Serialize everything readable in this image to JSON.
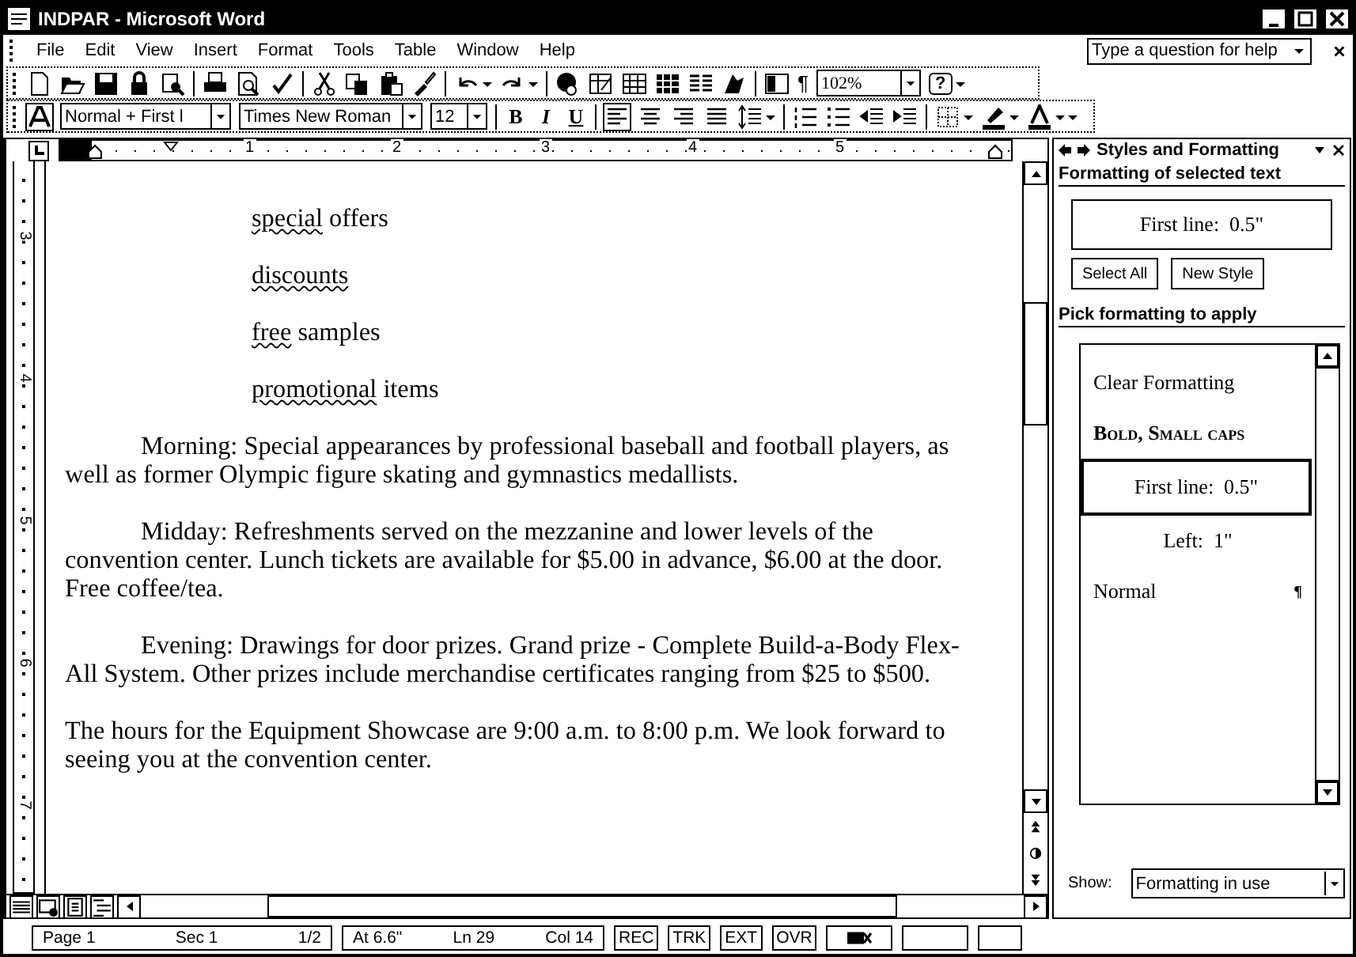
{
  "window": {
    "title": "INDPAR - Microsoft Word"
  },
  "menu": [
    "File",
    "Edit",
    "View",
    "Insert",
    "Format",
    "Tools",
    "Table",
    "Window",
    "Help"
  ],
  "help_search": {
    "placeholder": "Type a question for help"
  },
  "standard_toolbar": {
    "show_formatting": "¶",
    "zoom": "102%",
    "help": "?"
  },
  "formatting_toolbar": {
    "style": "Normal + First l",
    "font": "Times New Roman",
    "size": "12",
    "bold": "B",
    "italic": "I",
    "underline": "U",
    "alignment_buttons": [
      {
        "selected": true
      },
      {
        "selected": false
      },
      {
        "selected": false
      },
      {
        "selected": false
      }
    ]
  },
  "ruler": {
    "labels": [
      "1",
      "2",
      "3",
      "4",
      "5"
    ]
  },
  "vertical_ruler": {
    "labels": [
      "3",
      "4",
      "5",
      "6",
      "7"
    ]
  },
  "document": {
    "list_items": [
      {
        "flagged_word": "special",
        "text": "offers"
      },
      {
        "flagged_word": "discounts"
      },
      {
        "flagged_word": "free",
        "text": "samples"
      },
      {
        "flagged_word": "promotional",
        "text": "items"
      }
    ],
    "paragraphs": [
      {
        "first_line_indent": true,
        "lines": [
          "Morning: Special appearances by professional baseball and football players, as",
          "well as former Olympic figure skating and gymnastics medallists."
        ]
      },
      {
        "first_line_indent": true,
        "lines": [
          "Midday: Refreshments served on the mezzanine and lower levels of the",
          "convention center. Lunch tickets are available for $5.00 in advance, $6.00 at the door.",
          "Free coffee/tea."
        ]
      },
      {
        "first_line_indent": true,
        "lines": [
          "Evening: Drawings for door prizes. Grand prize - Complete Build-a-Body Flex-",
          "All System. Other prizes include merchandise certificates ranging from $25 to $500."
        ]
      },
      {
        "first_line_indent": false,
        "lines": [
          "The hours for the Equipment Showcase are 9:00 a.m. to 8:00 p.m. We look forward to",
          "seeing you at the convention center."
        ]
      }
    ]
  },
  "task_pane": {
    "title": "Styles and Formatting",
    "selected_heading": "Formatting of selected text",
    "selected_format": "First line:  0.5\"",
    "buttons": [
      "Select All",
      "New Style"
    ],
    "pick_heading": "Pick formatting to apply",
    "styles": [
      {
        "label": "Clear Formatting",
        "kind": "plain",
        "selected": false
      },
      {
        "label": "Bold, Small caps",
        "kind": "bold-smallcaps",
        "selected": false
      },
      {
        "label": "First line:  0.5\"",
        "kind": "centered",
        "selected": true
      },
      {
        "label": "Left:  1\"",
        "kind": "centered",
        "selected": false
      },
      {
        "label": "Normal",
        "kind": "paragraph",
        "mark": "¶",
        "selected": false
      }
    ],
    "show_label": "Show:",
    "show_value": "Formatting in use"
  },
  "status_bar": {
    "page": "Page 1",
    "section": "Sec 1",
    "pages": "1/2",
    "at": "At 6.6\"",
    "line": "Ln 29",
    "column": "Col 14",
    "modes": [
      "REC",
      "TRK",
      "EXT",
      "OVR"
    ]
  }
}
